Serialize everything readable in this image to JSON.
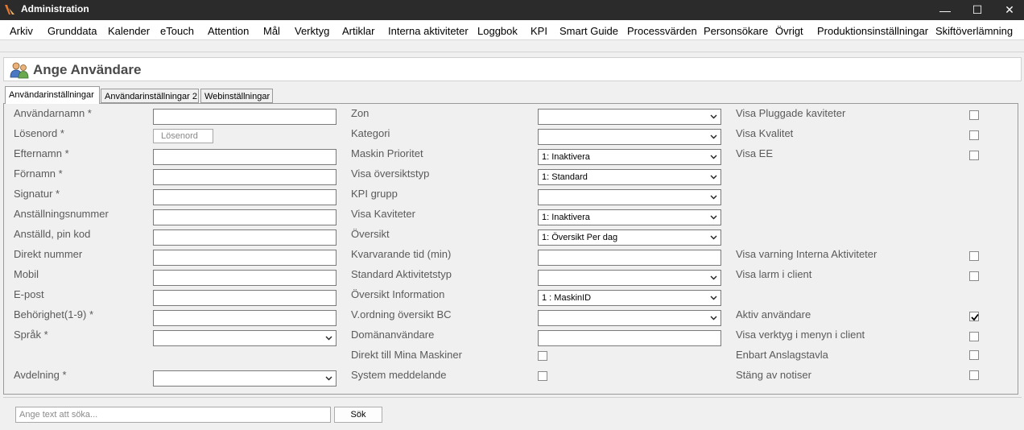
{
  "window": {
    "title": "Administration",
    "minimize_glyph": "—",
    "maximize_glyph": "☐",
    "close_glyph": "✕"
  },
  "menu": [
    "Arkiv",
    "Grunddata",
    "Kalender",
    "eTouch",
    "Attention",
    "Mål",
    "Verktyg",
    "Artiklar",
    "Interna aktiviteter",
    "Loggbok",
    "KPI",
    "Smart Guide",
    "Processvärden",
    "Personsökare",
    "Övrigt",
    "Produktionsinställningar",
    "Skiftöverlämning"
  ],
  "header": {
    "title": "Ange Användare",
    "icon": "users-icon"
  },
  "tabs": [
    "Användarinställningar",
    "Användarinställningar 2",
    "Webinställningar"
  ],
  "active_tab": 0,
  "col1": {
    "labels": [
      "Användarnamn *",
      "Lösenord   *",
      "Efternamn *",
      "Förnamn *",
      "Signatur *",
      "Anställningsnummer",
      "Anställd, pin kod",
      "Direkt nummer",
      "Mobil",
      "E-post",
      "Behörighet(1-9) *",
      "Språk *",
      "Avdelning *"
    ],
    "password_placeholder": "Lösenord",
    "sprak_value": "",
    "avdelning_value": ""
  },
  "col2": {
    "labels": [
      "Zon",
      "Kategori",
      "Maskin Prioritet",
      "Visa översiktstyp",
      "KPI grupp",
      "Visa Kaviteter",
      "Översikt",
      "Kvarvarande tid (min)",
      "Standard Aktivitetstyp",
      "Översikt Information",
      "V.ordning översikt BC",
      "Domänanvändare",
      "Direkt till Mina Maskiner",
      "System meddelande"
    ],
    "values": [
      "",
      "",
      "1: Inaktivera",
      "1: Standard",
      "",
      "1: Inaktivera",
      "1: Översikt Per dag",
      "",
      "",
      "1 : MaskinID",
      "",
      "",
      "",
      ""
    ],
    "direkt_checked": false,
    "system_checked": false
  },
  "col3": {
    "items": [
      {
        "label": "Visa Pluggade kaviteter",
        "checked": false
      },
      {
        "label": "Visa Kvalitet",
        "checked": false
      },
      {
        "label": "Visa EE",
        "checked": false
      },
      {
        "label": "Visa varning Interna Aktiviteter",
        "checked": false
      },
      {
        "label": "Visa larm i client",
        "checked": false
      },
      {
        "label": "Aktiv användare",
        "checked": true
      },
      {
        "label": "Visa verktyg i menyn i client",
        "checked": false
      },
      {
        "label": "Enbart Anslagstavla",
        "checked": false
      },
      {
        "label": "Stäng av notiser",
        "checked": false
      }
    ]
  },
  "search": {
    "placeholder": "Ange text att söka...",
    "value": "",
    "button_label": "Sök"
  }
}
